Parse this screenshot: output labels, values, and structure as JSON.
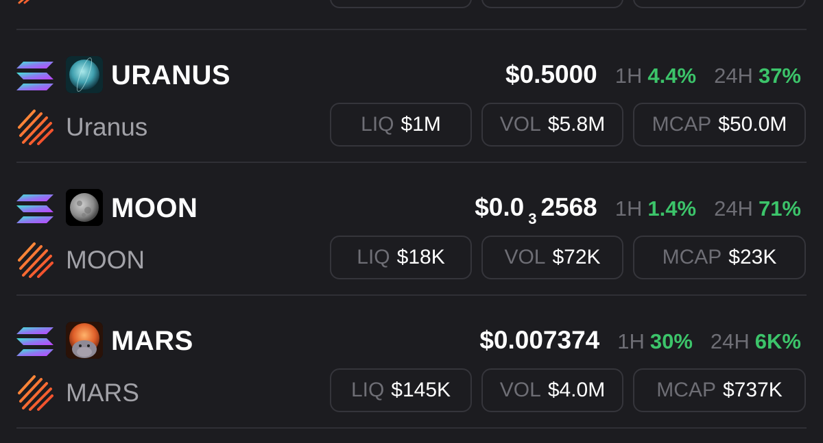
{
  "colors": {
    "background": "#1c1c20",
    "positive": "#3cc46a",
    "muted": "#6e6e75",
    "name_gray": "#a2a2a8",
    "border": "#35353b"
  },
  "tokens": [
    {
      "symbol": "URANUS",
      "name": "Uranus",
      "avatar_icon": "uranus-planet-icon",
      "chain_icon": "solana-icon",
      "source_icon": "fire-stripes-icon",
      "price_main": "$0.5000",
      "price_sub": "",
      "price_tail": "",
      "h1_label": "1H",
      "h1_value": "4.4%",
      "h24_label": "24H",
      "h24_value": "37%",
      "liq_label": "LIQ",
      "liq_value": "$1M",
      "vol_label": "VOL",
      "vol_value": "$5.8M",
      "mcap_label": "MCAP",
      "mcap_value": "$50.0M"
    },
    {
      "symbol": "MOON",
      "name": "MOON",
      "avatar_icon": "moon-icon",
      "chain_icon": "solana-icon",
      "source_icon": "fire-stripes-icon",
      "price_main": "$0.0",
      "price_sub": "3",
      "price_tail": "2568",
      "h1_label": "1H",
      "h1_value": "1.4%",
      "h24_label": "24H",
      "h24_value": "71%",
      "liq_label": "LIQ",
      "liq_value": "$18K",
      "vol_label": "VOL",
      "vol_value": "$72K",
      "mcap_label": "MCAP",
      "mcap_value": "$23K"
    },
    {
      "symbol": "MARS",
      "name": "MARS",
      "avatar_icon": "mars-hippo-icon",
      "chain_icon": "solana-icon",
      "source_icon": "fire-stripes-icon",
      "price_main": "$0.007374",
      "price_sub": "",
      "price_tail": "",
      "h1_label": "1H",
      "h1_value": "30%",
      "h24_label": "24H",
      "h24_value": "6K%",
      "liq_label": "LIQ",
      "liq_value": "$145K",
      "vol_label": "VOL",
      "vol_value": "$4.0M",
      "mcap_label": "MCAP",
      "mcap_value": "$737K"
    }
  ]
}
